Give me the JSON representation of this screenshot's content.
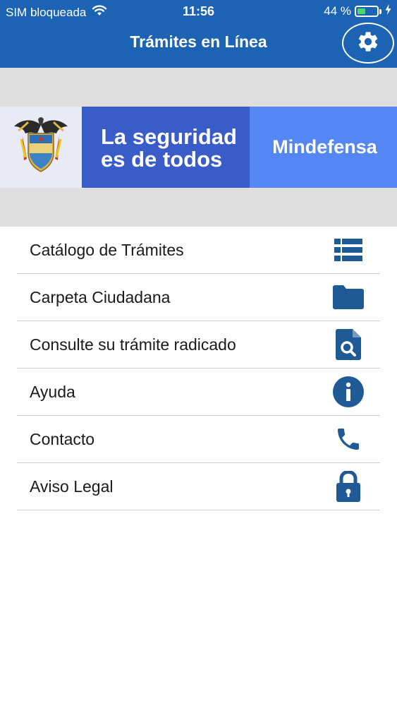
{
  "status_bar": {
    "carrier": "SIM bloqueada",
    "time": "11:56",
    "battery_percent": "44 %",
    "battery_level": 0.44
  },
  "header": {
    "title": "Trámites en Línea",
    "settings_icon": "gear-icon"
  },
  "banner": {
    "slogan_line1": "La seguridad",
    "slogan_line2": "es de todos",
    "ministry": "Mindefensa",
    "crest_icon": "colombia-coat-of-arms"
  },
  "menu": {
    "items": [
      {
        "label": "Catálogo de Trámites",
        "icon": "list-icon"
      },
      {
        "label": "Carpeta Ciudadana",
        "icon": "folder-icon"
      },
      {
        "label": "Consulte su trámite radicado",
        "icon": "document-search-icon"
      },
      {
        "label": "Ayuda",
        "icon": "info-icon"
      },
      {
        "label": "Contacto",
        "icon": "phone-icon"
      },
      {
        "label": "Aviso Legal",
        "icon": "lock-icon"
      }
    ]
  },
  "colors": {
    "header_blue": "#1c63b3",
    "icon_blue": "#1f5a96",
    "banner_dark_blue": "#3a5cc9",
    "banner_light_blue": "#5487f3",
    "separator_gray": "#dedede",
    "battery_green": "#4cd964"
  }
}
